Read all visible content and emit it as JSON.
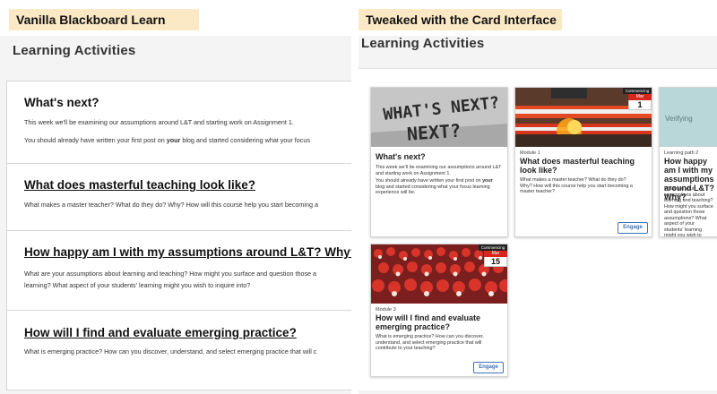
{
  "labels": {
    "left": "Vanilla Blackboard Learn",
    "right": "Tweaked with the Card Interface"
  },
  "left_panel": {
    "title": "Learning Activities",
    "items": [
      {
        "title": "What's next?",
        "lines": [
          "This week we'll be examining our assumptions around L&T and starting work on Assignment 1.",
          "You should already have written your first post on your blog and started considering what your focus"
        ]
      },
      {
        "title": "What does masterful teaching look like?",
        "lines": [
          "What makes a master teacher? What do they do? Why? How will this course help you start becoming a"
        ]
      },
      {
        "title": "How happy am I with my assumptions around L&T? Why?",
        "lines": [
          "What are your assumptions about learning and teaching? How might you surface and question those a",
          "learning? What aspect of your students' learning might you wish to inquire into?"
        ]
      },
      {
        "title": "How will I find and evaluate emerging practice?",
        "lines": [
          "What is emerging practice? How can you discover, understand, and select emerging practice that will c"
        ]
      }
    ]
  },
  "right_panel": {
    "title": "Learning Activities",
    "cards": [
      {
        "image_text": "WHAT'S NEXT?",
        "title": "What's next?",
        "text1": "This week we'll be examining our assumptions around L&T and starting work on Assignment 1.",
        "text2": "You should already have written your first post on your blog and started considering what your focus learning experience will be."
      },
      {
        "badge": "Commencing",
        "month": "Mar",
        "day": "1",
        "module": "Module 1",
        "title": "What does masterful teaching look like?",
        "text": "What makes a master teacher? What do they do? Why? How will this course help you start becoming a master teacher?",
        "button": "Engage"
      },
      {
        "image_text": "Verifying",
        "module": "Learning path 2",
        "title": "How happy am I with my assumptions around L&T? Why?",
        "text": "What are your assumptions about learning and teaching? How might you surface and question those assumptions? What aspect of your students' learning might you wish to inquire into?"
      },
      {
        "badge": "Commencing",
        "month": "Mar",
        "day": "15",
        "module": "Module 3",
        "title": "How will I find and evaluate emerging practice?",
        "text": "What is emerging practice? How can you discover, understand, and select emerging practice that will contribute to your teaching?",
        "button": "Engage"
      }
    ]
  },
  "colors": {
    "tag_bg": "#fbe9c6",
    "engage_blue": "#3b73b9",
    "calendar_red": "#d7261e"
  }
}
